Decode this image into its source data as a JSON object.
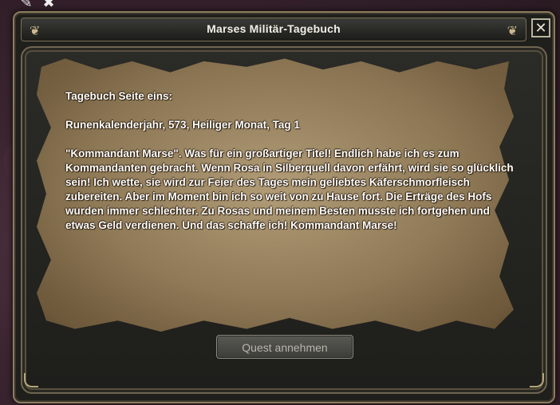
{
  "window": {
    "title": "Marses Militär-Tagebuch",
    "close_icon": "✕"
  },
  "top_icons": [
    {
      "name": "edit-icon",
      "glyph": "✎"
    },
    {
      "name": "close-icon",
      "glyph": "✖"
    }
  ],
  "diary": {
    "heading": "Tagebuch Seite eins:",
    "date": "Runenkalenderjahr, 573, Heiliger Monat, Tag 1",
    "body": "\"Kommandant Marse\". Was für ein großartiger Titel! Endlich habe ich es zum Kommandanten gebracht. Wenn Rosa in Silberquell davon erfährt, wird sie so glücklich sein! Ich wette, sie wird zur Feier des Tages mein geliebtes Käferschmorfleisch zubereiten. Aber im Moment bin ich so weit von zu Hause fort. Die Erträge des Hofs wurden immer schlechter. Zu Rosas und meinem Besten musste ich fortgehen und etwas Geld verdienen. Und das schaffe ich! Kommandant Marse!"
  },
  "actions": {
    "accept_quest": "Quest annehmen"
  },
  "colors": {
    "frame_gold": "#8b7d5e",
    "parchment": "#9a845f",
    "text": "#ffffff"
  }
}
